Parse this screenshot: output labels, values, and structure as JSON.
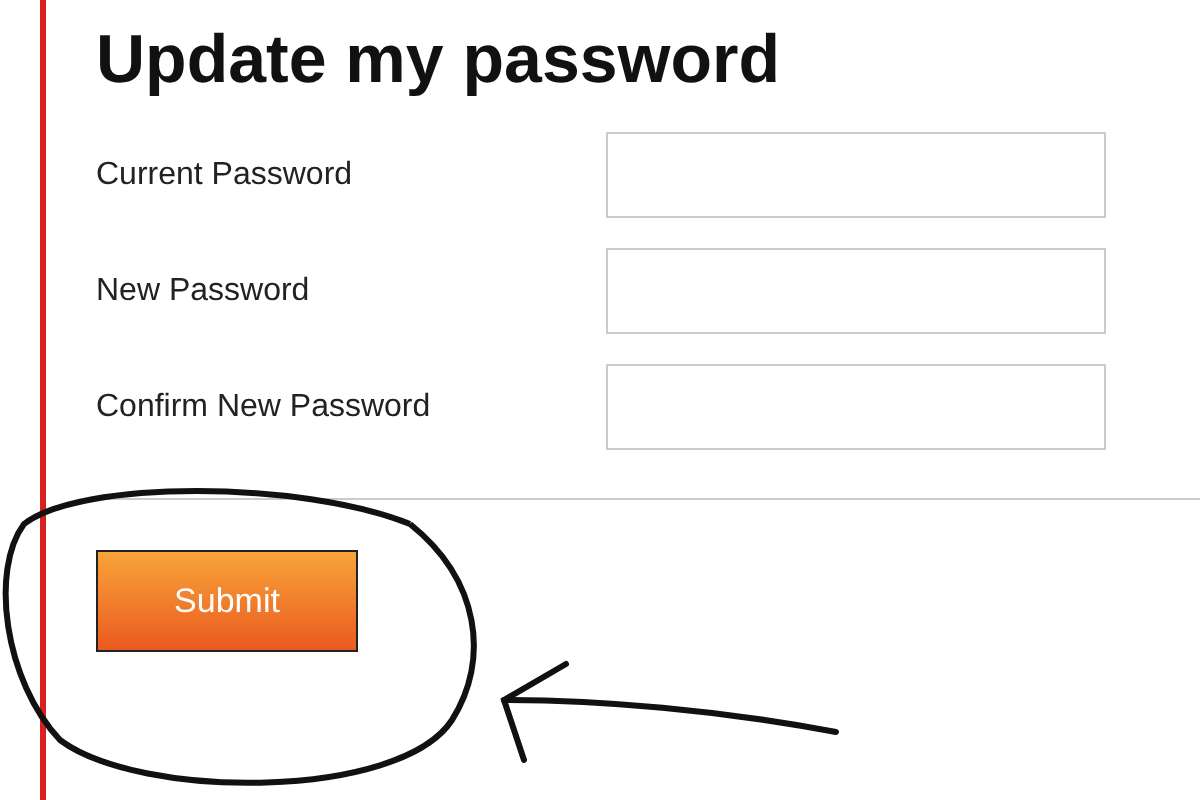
{
  "title": "Update my password",
  "fields": [
    {
      "label": "Current Password"
    },
    {
      "label": "New Password"
    },
    {
      "label": "Confirm New Password"
    }
  ],
  "submit": {
    "label": "Submit"
  }
}
